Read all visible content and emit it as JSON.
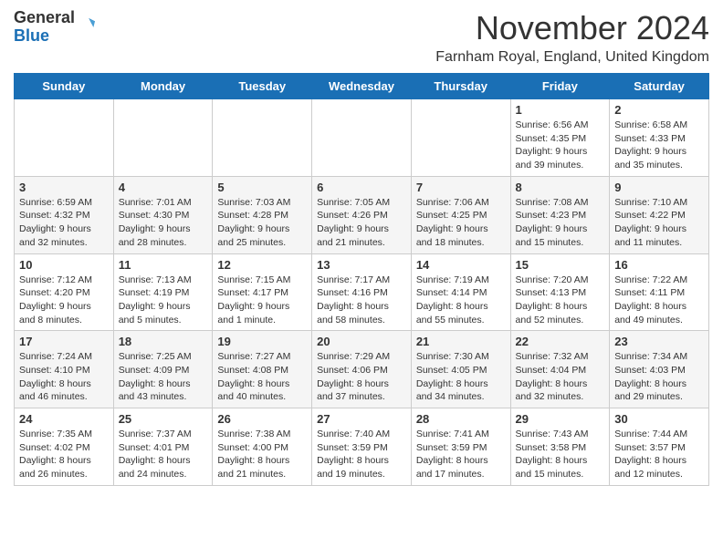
{
  "header": {
    "logo": {
      "general": "General",
      "blue": "Blue"
    },
    "title": "November 2024",
    "location": "Farnham Royal, England, United Kingdom"
  },
  "days_of_week": [
    "Sunday",
    "Monday",
    "Tuesday",
    "Wednesday",
    "Thursday",
    "Friday",
    "Saturday"
  ],
  "weeks": [
    [
      {
        "day": null,
        "info": null
      },
      {
        "day": null,
        "info": null
      },
      {
        "day": null,
        "info": null
      },
      {
        "day": null,
        "info": null
      },
      {
        "day": null,
        "info": null
      },
      {
        "day": "1",
        "info": "Sunrise: 6:56 AM\nSunset: 4:35 PM\nDaylight: 9 hours\nand 39 minutes."
      },
      {
        "day": "2",
        "info": "Sunrise: 6:58 AM\nSunset: 4:33 PM\nDaylight: 9 hours\nand 35 minutes."
      }
    ],
    [
      {
        "day": "3",
        "info": "Sunrise: 6:59 AM\nSunset: 4:32 PM\nDaylight: 9 hours\nand 32 minutes."
      },
      {
        "day": "4",
        "info": "Sunrise: 7:01 AM\nSunset: 4:30 PM\nDaylight: 9 hours\nand 28 minutes."
      },
      {
        "day": "5",
        "info": "Sunrise: 7:03 AM\nSunset: 4:28 PM\nDaylight: 9 hours\nand 25 minutes."
      },
      {
        "day": "6",
        "info": "Sunrise: 7:05 AM\nSunset: 4:26 PM\nDaylight: 9 hours\nand 21 minutes."
      },
      {
        "day": "7",
        "info": "Sunrise: 7:06 AM\nSunset: 4:25 PM\nDaylight: 9 hours\nand 18 minutes."
      },
      {
        "day": "8",
        "info": "Sunrise: 7:08 AM\nSunset: 4:23 PM\nDaylight: 9 hours\nand 15 minutes."
      },
      {
        "day": "9",
        "info": "Sunrise: 7:10 AM\nSunset: 4:22 PM\nDaylight: 9 hours\nand 11 minutes."
      }
    ],
    [
      {
        "day": "10",
        "info": "Sunrise: 7:12 AM\nSunset: 4:20 PM\nDaylight: 9 hours\nand 8 minutes."
      },
      {
        "day": "11",
        "info": "Sunrise: 7:13 AM\nSunset: 4:19 PM\nDaylight: 9 hours\nand 5 minutes."
      },
      {
        "day": "12",
        "info": "Sunrise: 7:15 AM\nSunset: 4:17 PM\nDaylight: 9 hours\nand 1 minute."
      },
      {
        "day": "13",
        "info": "Sunrise: 7:17 AM\nSunset: 4:16 PM\nDaylight: 8 hours\nand 58 minutes."
      },
      {
        "day": "14",
        "info": "Sunrise: 7:19 AM\nSunset: 4:14 PM\nDaylight: 8 hours\nand 55 minutes."
      },
      {
        "day": "15",
        "info": "Sunrise: 7:20 AM\nSunset: 4:13 PM\nDaylight: 8 hours\nand 52 minutes."
      },
      {
        "day": "16",
        "info": "Sunrise: 7:22 AM\nSunset: 4:11 PM\nDaylight: 8 hours\nand 49 minutes."
      }
    ],
    [
      {
        "day": "17",
        "info": "Sunrise: 7:24 AM\nSunset: 4:10 PM\nDaylight: 8 hours\nand 46 minutes."
      },
      {
        "day": "18",
        "info": "Sunrise: 7:25 AM\nSunset: 4:09 PM\nDaylight: 8 hours\nand 43 minutes."
      },
      {
        "day": "19",
        "info": "Sunrise: 7:27 AM\nSunset: 4:08 PM\nDaylight: 8 hours\nand 40 minutes."
      },
      {
        "day": "20",
        "info": "Sunrise: 7:29 AM\nSunset: 4:06 PM\nDaylight: 8 hours\nand 37 minutes."
      },
      {
        "day": "21",
        "info": "Sunrise: 7:30 AM\nSunset: 4:05 PM\nDaylight: 8 hours\nand 34 minutes."
      },
      {
        "day": "22",
        "info": "Sunrise: 7:32 AM\nSunset: 4:04 PM\nDaylight: 8 hours\nand 32 minutes."
      },
      {
        "day": "23",
        "info": "Sunrise: 7:34 AM\nSunset: 4:03 PM\nDaylight: 8 hours\nand 29 minutes."
      }
    ],
    [
      {
        "day": "24",
        "info": "Sunrise: 7:35 AM\nSunset: 4:02 PM\nDaylight: 8 hours\nand 26 minutes."
      },
      {
        "day": "25",
        "info": "Sunrise: 7:37 AM\nSunset: 4:01 PM\nDaylight: 8 hours\nand 24 minutes."
      },
      {
        "day": "26",
        "info": "Sunrise: 7:38 AM\nSunset: 4:00 PM\nDaylight: 8 hours\nand 21 minutes."
      },
      {
        "day": "27",
        "info": "Sunrise: 7:40 AM\nSunset: 3:59 PM\nDaylight: 8 hours\nand 19 minutes."
      },
      {
        "day": "28",
        "info": "Sunrise: 7:41 AM\nSunset: 3:59 PM\nDaylight: 8 hours\nand 17 minutes."
      },
      {
        "day": "29",
        "info": "Sunrise: 7:43 AM\nSunset: 3:58 PM\nDaylight: 8 hours\nand 15 minutes."
      },
      {
        "day": "30",
        "info": "Sunrise: 7:44 AM\nSunset: 3:57 PM\nDaylight: 8 hours\nand 12 minutes."
      }
    ]
  ]
}
